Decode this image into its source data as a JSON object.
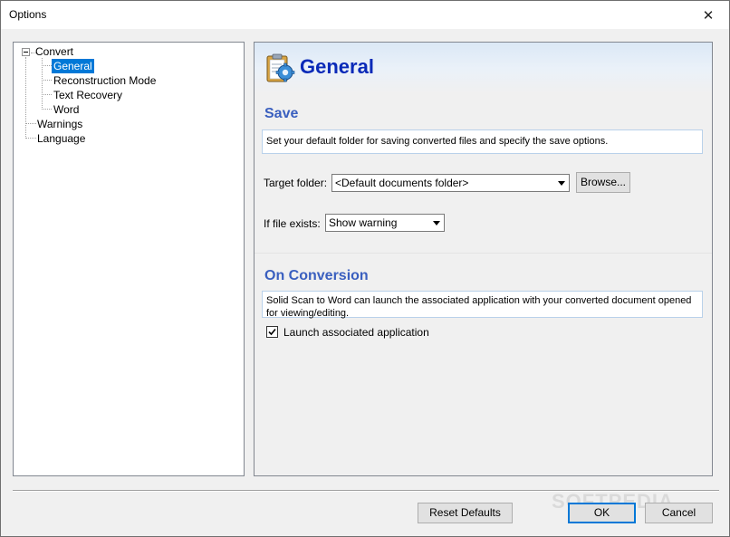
{
  "window": {
    "title": "Options"
  },
  "tree": {
    "items": [
      {
        "label": "Convert"
      },
      {
        "label": "General"
      },
      {
        "label": "Reconstruction Mode"
      },
      {
        "label": "Text Recovery"
      },
      {
        "label": "Word"
      },
      {
        "label": "Warnings"
      },
      {
        "label": "Language"
      }
    ],
    "selected": "General"
  },
  "panel": {
    "title": "General",
    "save": {
      "title": "Save",
      "description": "Set your default folder for saving converted files and specify the save options.",
      "target_folder_label": "Target folder:",
      "target_folder_value": "<Default documents folder>",
      "browse_label": "Browse...",
      "if_exists_label": "If file exists:",
      "if_exists_value": "Show warning"
    },
    "conversion": {
      "title": "On Conversion",
      "description": "Solid Scan to Word can launch the associated application with your converted document opened for viewing/editing.",
      "launch_label": "Launch associated application",
      "launch_checked": true
    }
  },
  "footer": {
    "reset_label": "Reset Defaults",
    "ok_label": "OK",
    "cancel_label": "Cancel"
  },
  "watermark": "SOFTPEDIA",
  "colors": {
    "accent": "#0078d7",
    "header_title": "#0a2ab8",
    "section_title": "#3a5fbf"
  }
}
